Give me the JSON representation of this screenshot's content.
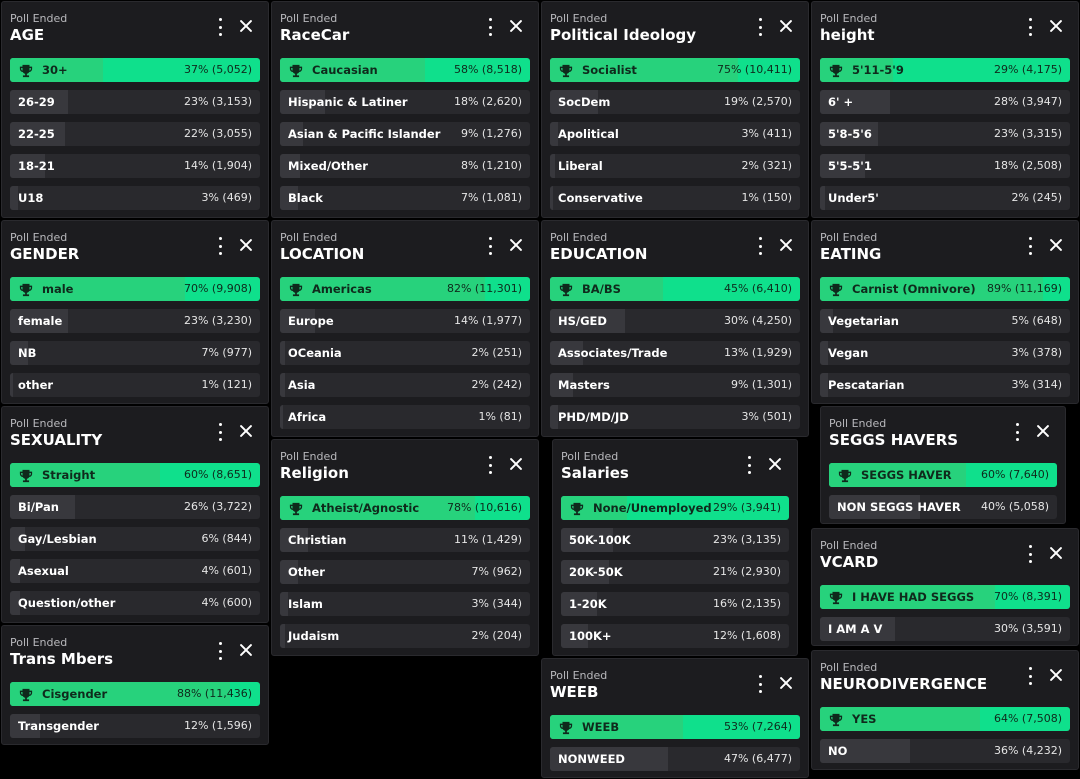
{
  "polls": [
    {
      "id": "age",
      "status": "Poll Ended",
      "title": "AGE",
      "options": [
        {
          "label": "30+",
          "pct": 37,
          "text": "37% (5,052)",
          "winner": true
        },
        {
          "label": "26-29",
          "pct": 23,
          "text": "23% (3,153)"
        },
        {
          "label": "22-25",
          "pct": 22,
          "text": "22% (3,055)"
        },
        {
          "label": "18-21",
          "pct": 14,
          "text": "14% (1,904)"
        },
        {
          "label": "U18",
          "pct": 3,
          "text": "3% (469)"
        }
      ]
    },
    {
      "id": "racecar",
      "status": "Poll Ended",
      "title": "RaceCar",
      "options": [
        {
          "label": "Caucasian",
          "pct": 58,
          "text": "58% (8,518)",
          "winner": true
        },
        {
          "label": "Hispanic & Latiner",
          "pct": 18,
          "text": "18% (2,620)"
        },
        {
          "label": "Asian & Pacific Islander",
          "pct": 9,
          "text": "9% (1,276)"
        },
        {
          "label": "Mixed/Other",
          "pct": 8,
          "text": "8% (1,210)"
        },
        {
          "label": "Black",
          "pct": 7,
          "text": "7% (1,081)"
        }
      ]
    },
    {
      "id": "ideology",
      "status": "Poll Ended",
      "title": "Political Ideology",
      "options": [
        {
          "label": "Socialist",
          "pct": 75,
          "text": "75% (10,411)",
          "winner": true
        },
        {
          "label": "SocDem",
          "pct": 19,
          "text": "19% (2,570)"
        },
        {
          "label": "Apolitical",
          "pct": 3,
          "text": "3% (411)"
        },
        {
          "label": "Liberal",
          "pct": 2,
          "text": "2% (321)"
        },
        {
          "label": "Conservative",
          "pct": 1,
          "text": "1% (150)"
        }
      ]
    },
    {
      "id": "height",
      "status": "Poll Ended",
      "title": "height",
      "options": [
        {
          "label": "5'11-5'9",
          "pct": 29,
          "text": "29% (4,175)",
          "winner": true
        },
        {
          "label": "6' +",
          "pct": 28,
          "text": "28% (3,947)"
        },
        {
          "label": "5'8-5'6",
          "pct": 23,
          "text": "23% (3,315)"
        },
        {
          "label": "5'5-5'1",
          "pct": 18,
          "text": "18% (2,508)"
        },
        {
          "label": "Under5'",
          "pct": 2,
          "text": "2% (245)"
        }
      ]
    },
    {
      "id": "gender",
      "status": "Poll Ended",
      "title": "GENDER",
      "options": [
        {
          "label": "male",
          "pct": 70,
          "text": "70% (9,908)",
          "winner": true
        },
        {
          "label": "female",
          "pct": 23,
          "text": "23% (3,230)"
        },
        {
          "label": "NB",
          "pct": 7,
          "text": "7% (977)"
        },
        {
          "label": "other",
          "pct": 1,
          "text": "1% (121)"
        }
      ]
    },
    {
      "id": "location",
      "status": "Poll Ended",
      "title": "LOCATION",
      "options": [
        {
          "label": "Americas",
          "pct": 82,
          "text": "82% (11,301)",
          "winner": true
        },
        {
          "label": "Europe",
          "pct": 14,
          "text": "14% (1,977)"
        },
        {
          "label": "OCeania",
          "pct": 2,
          "text": "2% (251)"
        },
        {
          "label": "Asia",
          "pct": 2,
          "text": "2% (242)"
        },
        {
          "label": "Africa",
          "pct": 1,
          "text": "1% (81)"
        }
      ]
    },
    {
      "id": "education",
      "status": "Poll Ended",
      "title": "EDUCATION",
      "options": [
        {
          "label": "BA/BS",
          "pct": 45,
          "text": "45% (6,410)",
          "winner": true
        },
        {
          "label": "HS/GED",
          "pct": 30,
          "text": "30% (4,250)"
        },
        {
          "label": "Associates/Trade",
          "pct": 13,
          "text": "13% (1,929)"
        },
        {
          "label": "Masters",
          "pct": 9,
          "text": "9% (1,301)"
        },
        {
          "label": "PHD/MD/JD",
          "pct": 3,
          "text": "3% (501)"
        }
      ]
    },
    {
      "id": "eating",
      "status": "Poll Ended",
      "title": "EATING",
      "options": [
        {
          "label": "Carnist (Omnivore)",
          "pct": 89,
          "text": "89% (11,169)",
          "winner": true
        },
        {
          "label": "Vegetarian",
          "pct": 5,
          "text": "5% (648)"
        },
        {
          "label": "Vegan",
          "pct": 3,
          "text": "3% (378)"
        },
        {
          "label": "Pescatarian",
          "pct": 3,
          "text": "3% (314)"
        }
      ]
    },
    {
      "id": "sexuality",
      "status": "Poll Ended",
      "title": "SEXUALITY",
      "options": [
        {
          "label": "Straight",
          "pct": 60,
          "text": "60% (8,651)",
          "winner": true
        },
        {
          "label": "Bi/Pan",
          "pct": 26,
          "text": "26% (3,722)"
        },
        {
          "label": "Gay/Lesbian",
          "pct": 6,
          "text": "6% (844)"
        },
        {
          "label": "Asexual",
          "pct": 4,
          "text": "4% (601)"
        },
        {
          "label": "Question/other",
          "pct": 4,
          "text": "4% (600)"
        }
      ]
    },
    {
      "id": "religion",
      "status": "Poll Ended",
      "title": "Religion",
      "options": [
        {
          "label": "Atheist/Agnostic",
          "pct": 78,
          "text": "78% (10,616)",
          "winner": true
        },
        {
          "label": "Christian",
          "pct": 11,
          "text": "11% (1,429)"
        },
        {
          "label": "Other",
          "pct": 7,
          "text": "7% (962)"
        },
        {
          "label": "Islam",
          "pct": 3,
          "text": "3% (344)"
        },
        {
          "label": "Judaism",
          "pct": 2,
          "text": "2% (204)"
        }
      ]
    },
    {
      "id": "salaries",
      "status": "Poll Ended",
      "title": "Salaries",
      "options": [
        {
          "label": "None/Unemployed",
          "pct": 29,
          "text": "29% (3,941)",
          "winner": true
        },
        {
          "label": "50K-100K",
          "pct": 23,
          "text": "23% (3,135)"
        },
        {
          "label": "20K-50K",
          "pct": 21,
          "text": "21% (2,930)"
        },
        {
          "label": "1-20K",
          "pct": 16,
          "text": "16% (2,135)"
        },
        {
          "label": "100K+",
          "pct": 12,
          "text": "12% (1,608)"
        }
      ]
    },
    {
      "id": "seggs",
      "status": "Poll Ended",
      "title": "SEGGS HAVERS",
      "options": [
        {
          "label": "SEGGS HAVER",
          "pct": 60,
          "text": "60% (7,640)",
          "winner": true
        },
        {
          "label": "NON SEGGS HAVER",
          "pct": 40,
          "text": "40% (5,058)"
        }
      ]
    },
    {
      "id": "vcard",
      "status": "Poll Ended",
      "title": "VCARD",
      "options": [
        {
          "label": "I HAVE HAD SEGGS",
          "pct": 70,
          "text": "70% (8,391)",
          "winner": true
        },
        {
          "label": "I AM A V",
          "pct": 30,
          "text": "30% (3,591)"
        }
      ]
    },
    {
      "id": "trans",
      "status": "Poll Ended",
      "title": "Trans Mbers",
      "options": [
        {
          "label": "Cisgender",
          "pct": 88,
          "text": "88% (11,436)",
          "winner": true
        },
        {
          "label": "Transgender",
          "pct": 12,
          "text": "12% (1,596)"
        }
      ]
    },
    {
      "id": "weeb",
      "status": "Poll Ended",
      "title": "WEEB",
      "options": [
        {
          "label": "WEEB",
          "pct": 53,
          "text": "53% (7,264)",
          "winner": true
        },
        {
          "label": "NONWEED",
          "pct": 47,
          "text": "47% (6,477)"
        }
      ]
    },
    {
      "id": "neuro",
      "status": "Poll Ended",
      "title": "NEURODIVERGENCE",
      "options": [
        {
          "label": "YES",
          "pct": 64,
          "text": "64% (7,508)",
          "winner": true
        },
        {
          "label": "NO",
          "pct": 36,
          "text": "36% (4,232)"
        }
      ]
    }
  ],
  "icons": {
    "winner": "trophy-icon",
    "menu": "more-vertical-icon",
    "close": "close-icon"
  },
  "colors": {
    "winner_bg": "#0fe08c",
    "winner_fill": "#27d27c",
    "card_bg": "#1c1c1f",
    "option_bg": "#29292d",
    "option_fill": "#38383d"
  }
}
